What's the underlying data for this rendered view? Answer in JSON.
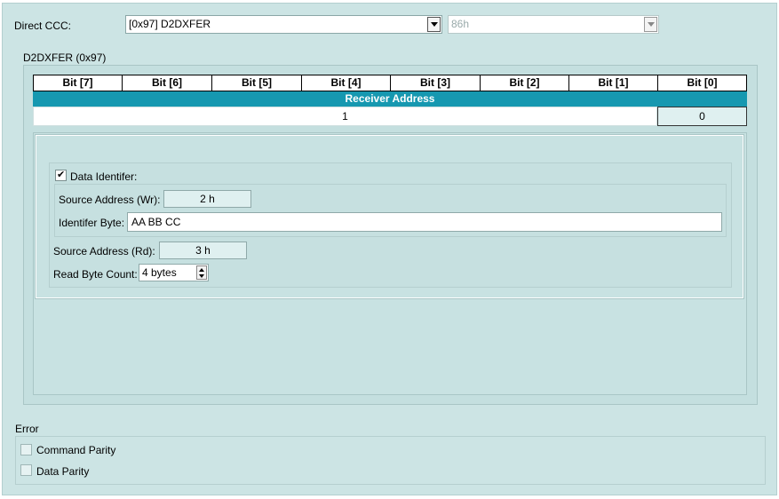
{
  "direct_ccc": {
    "label": "Direct CCC:",
    "selected": "[0x97] D2DXFER",
    "secondary_value": "86h"
  },
  "register": {
    "title": "D2DXFER (0x97)",
    "bit_headers": [
      "Bit [7]",
      "Bit [6]",
      "Bit [5]",
      "Bit [4]",
      "Bit [3]",
      "Bit [2]",
      "Bit [1]",
      "Bit [0]"
    ],
    "field_name": "Receiver Address",
    "value_main": "1",
    "value_bit0": "0"
  },
  "data_identifier": {
    "checkbox_label": "Data Identifer:",
    "checked": true,
    "source_wr_label": "Source Address (Wr):",
    "source_wr_value": "2 h",
    "identifier_byte_label": "Identifer Byte:",
    "identifier_byte_value": "AA BB CC",
    "source_rd_label": "Source Address (Rd):",
    "source_rd_value": "3 h",
    "read_count_label": "Read Byte Count:",
    "read_count_value": "4 bytes"
  },
  "error": {
    "title": "Error",
    "items": [
      {
        "label": "Command Parity",
        "checked": false
      },
      {
        "label": "Data Parity",
        "checked": false
      }
    ]
  },
  "colors": {
    "panel_bg": "#cce4e4",
    "accent_bar": "#1698b0"
  }
}
